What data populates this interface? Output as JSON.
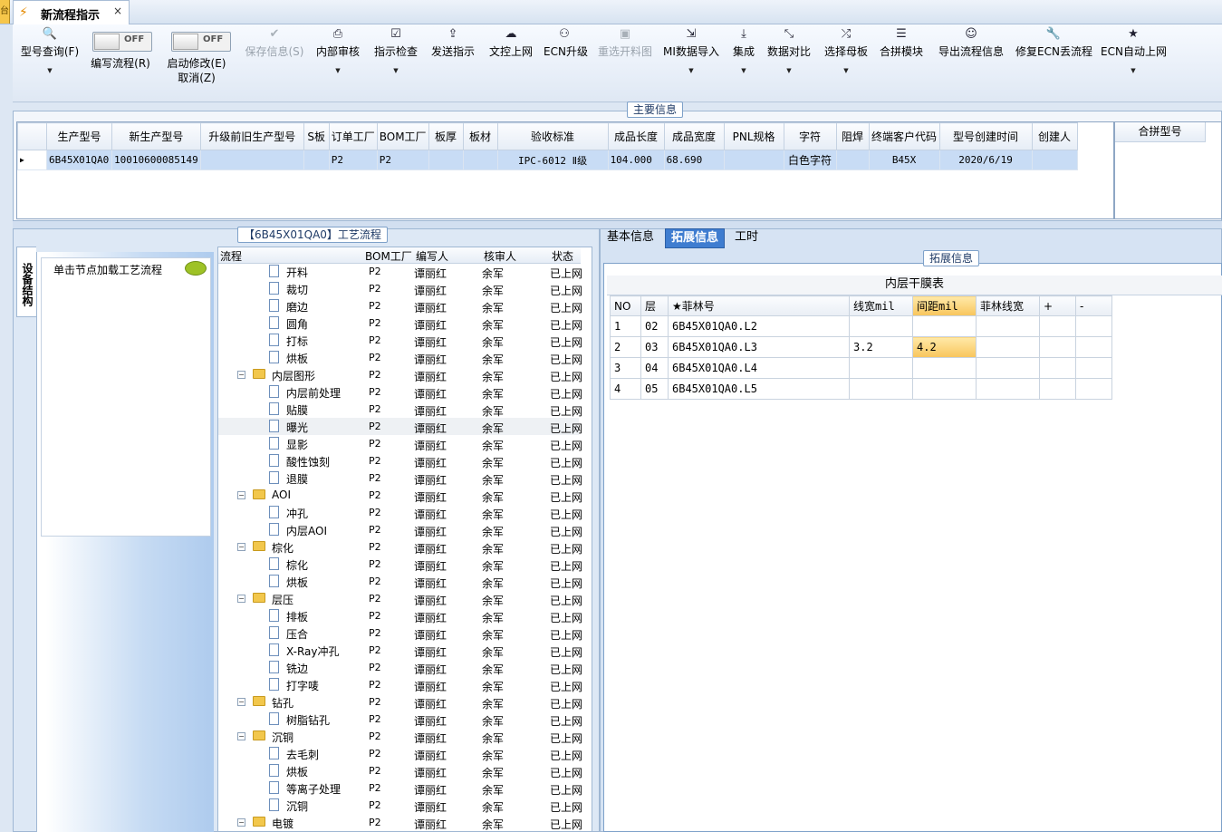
{
  "window": {
    "tab_title": "新流程指示",
    "close": "×",
    "left_tab": "台"
  },
  "toolbar": {
    "items": [
      {
        "icon": "search-icon",
        "glyph": "🔍",
        "label": "型号查询(F)",
        "dropdown": true,
        "disabled": false
      },
      {
        "icon": "save-icon",
        "glyph": "✔",
        "label": "保存信息(S)",
        "dropdown": false,
        "disabled": true
      },
      {
        "icon": "printer-icon",
        "glyph": "⎙",
        "label": "内部审核",
        "dropdown": true,
        "disabled": false
      },
      {
        "icon": "check-icon",
        "glyph": "☑",
        "label": "指示检查",
        "dropdown": true,
        "disabled": false
      },
      {
        "icon": "upload-icon",
        "glyph": "⇪",
        "label": "发送指示",
        "dropdown": false,
        "disabled": false
      },
      {
        "icon": "cloud-upload-icon",
        "glyph": "☁",
        "label": "文控上网",
        "dropdown": false,
        "disabled": false
      },
      {
        "icon": "binoculars-icon",
        "glyph": "⚇",
        "label": "ECN升级",
        "dropdown": false,
        "disabled": false
      },
      {
        "icon": "image-icon",
        "glyph": "▣",
        "label": "重选开料图",
        "dropdown": false,
        "disabled": true
      },
      {
        "icon": "import-icon",
        "glyph": "⇲",
        "label": "MI数据导入",
        "dropdown": true,
        "disabled": false
      },
      {
        "icon": "download-icon",
        "glyph": "⤓",
        "label": "集成",
        "dropdown": true,
        "disabled": false
      },
      {
        "icon": "compare-icon",
        "glyph": "⤡",
        "label": "数据对比",
        "dropdown": true,
        "disabled": false
      },
      {
        "icon": "shuffle-icon",
        "glyph": "⤮",
        "label": "选择母板",
        "dropdown": true,
        "disabled": false
      },
      {
        "icon": "list-icon",
        "glyph": "☰",
        "label": "合拼模块",
        "dropdown": false,
        "disabled": false
      },
      {
        "icon": "smile-icon",
        "glyph": "☺",
        "label": "导出流程信息",
        "dropdown": false,
        "disabled": false
      },
      {
        "icon": "wrench-icon",
        "glyph": "🔧",
        "label": "修复ECN丢流程",
        "dropdown": false,
        "disabled": false
      },
      {
        "icon": "star-icon",
        "glyph": "★",
        "label": "ECN自动上网",
        "dropdown": true,
        "disabled": false
      }
    ],
    "toggle1": {
      "state": "OFF",
      "label": "编写流程(R)"
    },
    "toggle2": {
      "state": "OFF",
      "label": "启动修改(E)",
      "label2": "取消(Z)"
    }
  },
  "main_info": {
    "group_title": "主要信息",
    "columns": [
      "生产型号",
      "新生产型号",
      "升级前旧生产型号",
      "S板",
      "订单工厂",
      "BOM工厂",
      "板厚",
      "板材",
      "验收标准",
      "成品长度",
      "成品宽度",
      "PNL规格",
      "字符",
      "阻焊",
      "终端客户代码",
      "型号创建时间",
      "创建人"
    ],
    "row": [
      "6B45X01QA0",
      "10010600085149",
      "",
      "",
      "P2",
      "P2",
      "",
      "",
      "IPC-6012 Ⅱ级",
      "104.000",
      "68.690",
      "",
      "白色字符",
      "",
      "B45X",
      "2020/6/19",
      ""
    ],
    "merge_header": "合拼型号"
  },
  "left": {
    "vertical_tab": "设备结构",
    "node_hint": "单击节点加载工艺流程",
    "tree_title": "【6B45X01QA0】工艺流程",
    "tree_headers": [
      "流程",
      "BOM工厂",
      "编写人",
      "核审人",
      "状态"
    ],
    "tree_rows": [
      {
        "name": "开料",
        "level": 2,
        "folder": false,
        "bom": "P2",
        "writer": "谭丽红",
        "reviewer": "余军",
        "status": "已上网"
      },
      {
        "name": "裁切",
        "level": 2,
        "folder": false,
        "bom": "P2",
        "writer": "谭丽红",
        "reviewer": "余军",
        "status": "已上网"
      },
      {
        "name": "磨边",
        "level": 2,
        "folder": false,
        "bom": "P2",
        "writer": "谭丽红",
        "reviewer": "余军",
        "status": "已上网"
      },
      {
        "name": "圆角",
        "level": 2,
        "folder": false,
        "bom": "P2",
        "writer": "谭丽红",
        "reviewer": "余军",
        "status": "已上网"
      },
      {
        "name": "打标",
        "level": 2,
        "folder": false,
        "bom": "P2",
        "writer": "谭丽红",
        "reviewer": "余军",
        "status": "已上网"
      },
      {
        "name": "烘板",
        "level": 2,
        "folder": false,
        "bom": "P2",
        "writer": "谭丽红",
        "reviewer": "余军",
        "status": "已上网"
      },
      {
        "name": "内层图形",
        "level": 1,
        "folder": true,
        "bom": "P2",
        "writer": "谭丽红",
        "reviewer": "余军",
        "status": "已上网"
      },
      {
        "name": "内层前处理",
        "level": 2,
        "folder": false,
        "bom": "P2",
        "writer": "谭丽红",
        "reviewer": "余军",
        "status": "已上网"
      },
      {
        "name": "贴膜",
        "level": 2,
        "folder": false,
        "bom": "P2",
        "writer": "谭丽红",
        "reviewer": "余军",
        "status": "已上网"
      },
      {
        "name": "曝光",
        "level": 2,
        "folder": false,
        "bom": "P2",
        "writer": "谭丽红",
        "reviewer": "余军",
        "status": "已上网",
        "selected": true
      },
      {
        "name": "显影",
        "level": 2,
        "folder": false,
        "bom": "P2",
        "writer": "谭丽红",
        "reviewer": "余军",
        "status": "已上网"
      },
      {
        "name": "酸性蚀刻",
        "level": 2,
        "folder": false,
        "bom": "P2",
        "writer": "谭丽红",
        "reviewer": "余军",
        "status": "已上网"
      },
      {
        "name": "退膜",
        "level": 2,
        "folder": false,
        "bom": "P2",
        "writer": "谭丽红",
        "reviewer": "余军",
        "status": "已上网"
      },
      {
        "name": "AOI",
        "level": 1,
        "folder": true,
        "bom": "P2",
        "writer": "谭丽红",
        "reviewer": "余军",
        "status": "已上网"
      },
      {
        "name": "冲孔",
        "level": 2,
        "folder": false,
        "bom": "P2",
        "writer": "谭丽红",
        "reviewer": "余军",
        "status": "已上网"
      },
      {
        "name": "内层AOI",
        "level": 2,
        "folder": false,
        "bom": "P2",
        "writer": "谭丽红",
        "reviewer": "余军",
        "status": "已上网"
      },
      {
        "name": "棕化",
        "level": 1,
        "folder": true,
        "bom": "P2",
        "writer": "谭丽红",
        "reviewer": "余军",
        "status": "已上网"
      },
      {
        "name": "棕化",
        "level": 2,
        "folder": false,
        "bom": "P2",
        "writer": "谭丽红",
        "reviewer": "余军",
        "status": "已上网"
      },
      {
        "name": "烘板",
        "level": 2,
        "folder": false,
        "bom": "P2",
        "writer": "谭丽红",
        "reviewer": "余军",
        "status": "已上网"
      },
      {
        "name": "层压",
        "level": 1,
        "folder": true,
        "bom": "P2",
        "writer": "谭丽红",
        "reviewer": "余军",
        "status": "已上网"
      },
      {
        "name": "排板",
        "level": 2,
        "folder": false,
        "bom": "P2",
        "writer": "谭丽红",
        "reviewer": "余军",
        "status": "已上网"
      },
      {
        "name": "压合",
        "level": 2,
        "folder": false,
        "bom": "P2",
        "writer": "谭丽红",
        "reviewer": "余军",
        "status": "已上网"
      },
      {
        "name": "X-Ray冲孔",
        "level": 2,
        "folder": false,
        "bom": "P2",
        "writer": "谭丽红",
        "reviewer": "余军",
        "status": "已上网"
      },
      {
        "name": "铣边",
        "level": 2,
        "folder": false,
        "bom": "P2",
        "writer": "谭丽红",
        "reviewer": "余军",
        "status": "已上网"
      },
      {
        "name": "打字唛",
        "level": 2,
        "folder": false,
        "bom": "P2",
        "writer": "谭丽红",
        "reviewer": "余军",
        "status": "已上网"
      },
      {
        "name": "钻孔",
        "level": 1,
        "folder": true,
        "bom": "P2",
        "writer": "谭丽红",
        "reviewer": "余军",
        "status": "已上网"
      },
      {
        "name": "树脂钻孔",
        "level": 2,
        "folder": false,
        "bom": "P2",
        "writer": "谭丽红",
        "reviewer": "余军",
        "status": "已上网"
      },
      {
        "name": "沉铜",
        "level": 1,
        "folder": true,
        "bom": "P2",
        "writer": "谭丽红",
        "reviewer": "余军",
        "status": "已上网"
      },
      {
        "name": "去毛刺",
        "level": 2,
        "folder": false,
        "bom": "P2",
        "writer": "谭丽红",
        "reviewer": "余军",
        "status": "已上网"
      },
      {
        "name": "烘板",
        "level": 2,
        "folder": false,
        "bom": "P2",
        "writer": "谭丽红",
        "reviewer": "余军",
        "status": "已上网"
      },
      {
        "name": "等离子处理",
        "level": 2,
        "folder": false,
        "bom": "P2",
        "writer": "谭丽红",
        "reviewer": "余军",
        "status": "已上网"
      },
      {
        "name": "沉铜",
        "level": 2,
        "folder": false,
        "bom": "P2",
        "writer": "谭丽红",
        "reviewer": "余军",
        "status": "已上网"
      },
      {
        "name": "电镀",
        "level": 1,
        "folder": true,
        "bom": "P2",
        "writer": "谭丽红",
        "reviewer": "余军",
        "status": "已上网"
      }
    ]
  },
  "right": {
    "tabs": [
      "基本信息",
      "拓展信息",
      "工时"
    ],
    "active_tab": 1,
    "group_title": "拓展信息",
    "film_title": "内层干膜表",
    "film_headers": [
      "NO",
      "层",
      "★菲林号",
      "线宽mil",
      "间距mil",
      "菲林线宽",
      "+",
      "-"
    ],
    "film_rows": [
      [
        "1",
        "02",
        "6B45X01QA0.L2",
        "",
        "",
        "",
        "",
        ""
      ],
      [
        "2",
        "03",
        "6B45X01QA0.L3",
        "3.2",
        "4.2",
        "",
        "",
        ""
      ],
      [
        "3",
        "04",
        "6B45X01QA0.L4",
        "",
        "",
        "",
        "",
        ""
      ],
      [
        "4",
        "05",
        "6B45X01QA0.L5",
        "",
        "",
        "",
        "",
        ""
      ]
    ]
  }
}
